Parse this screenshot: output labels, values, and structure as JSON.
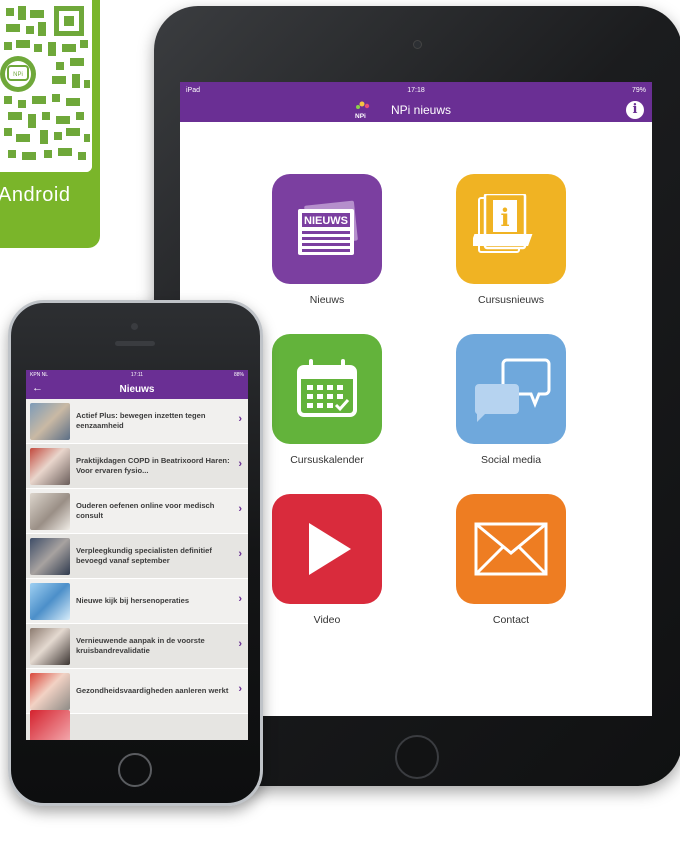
{
  "qr_badge": {
    "label": "Android"
  },
  "ipad": {
    "status": {
      "left": "iPad",
      "time": "17:18",
      "right": "79%"
    },
    "nav": {
      "title": "NPi nieuws",
      "logo_text": "NPi",
      "info_glyph": "i"
    },
    "tiles": [
      {
        "label": "Nieuws",
        "color": "#7b3fa0",
        "icon": "newspaper-icon",
        "icon_text": "NIEUWS"
      },
      {
        "label": "Cursusnieuws",
        "color": "#f0b323",
        "icon": "info-document-icon",
        "icon_text": "i"
      },
      {
        "label": "Cursuskalender",
        "color": "#63b33b",
        "icon": "calendar-icon"
      },
      {
        "label": "Social media",
        "color": "#6fa8dc",
        "icon": "chat-bubbles-icon"
      },
      {
        "label": "Video",
        "color": "#d92b3c",
        "icon": "play-icon"
      },
      {
        "label": "Contact",
        "color": "#ee7d22",
        "icon": "envelope-icon"
      }
    ]
  },
  "iphone": {
    "status": {
      "left": "KPN NL",
      "time": "17:11",
      "right": "88%"
    },
    "nav": {
      "title": "Nieuws",
      "back_glyph": "←"
    },
    "news": [
      {
        "title": "Actief Plus: bewegen inzetten tegen eenzaamheid",
        "chevron": "›"
      },
      {
        "title": "Praktijkdagen COPD in Beatrixoord Haren: Voor ervaren fysio...",
        "chevron": "›"
      },
      {
        "title": "Ouderen oefenen online voor medisch consult",
        "chevron": "›"
      },
      {
        "title": "Verpleegkundig specialisten definitief bevoegd vanaf september",
        "chevron": "›"
      },
      {
        "title": "Nieuwe kijk bij hersenoperaties",
        "chevron": "›"
      },
      {
        "title": "Vernieuwende aanpak in de voorste kruisbandrevalidatie",
        "chevron": "›"
      },
      {
        "title": "Gezondheidsvaardigheden aanleren werkt",
        "chevron": "›"
      }
    ]
  }
}
